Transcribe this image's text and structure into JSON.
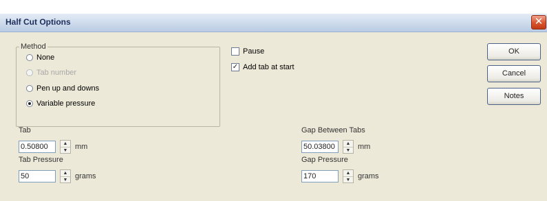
{
  "window": {
    "title": "Half Cut Options",
    "close_glyph": "✕"
  },
  "method": {
    "legend": "Method",
    "options": [
      {
        "label": "None",
        "selected": false,
        "enabled": true
      },
      {
        "label": "Tab number",
        "selected": false,
        "enabled": false
      },
      {
        "label": "Pen up and downs",
        "selected": false,
        "enabled": true
      },
      {
        "label": "Variable pressure",
        "selected": true,
        "enabled": true
      }
    ]
  },
  "pause": {
    "label": "Pause",
    "checked": false
  },
  "add_tab": {
    "label": "Add tab at start",
    "checked": true,
    "mark": "✓"
  },
  "buttons": {
    "ok": "OK",
    "cancel": "Cancel",
    "notes": "Notes"
  },
  "tab": {
    "label": "Tab",
    "value": "0.50800",
    "unit": "mm"
  },
  "tab_pressure": {
    "label": "Tab Pressure",
    "value": "50",
    "unit": "grams"
  },
  "gap_between_tabs": {
    "label": "Gap Between Tabs",
    "value": "50.03800",
    "unit": "mm"
  },
  "gap_pressure": {
    "label": "Gap Pressure",
    "value": "170",
    "unit": "grams"
  },
  "icons": {
    "spin_up": "▲",
    "spin_down": "▼"
  }
}
